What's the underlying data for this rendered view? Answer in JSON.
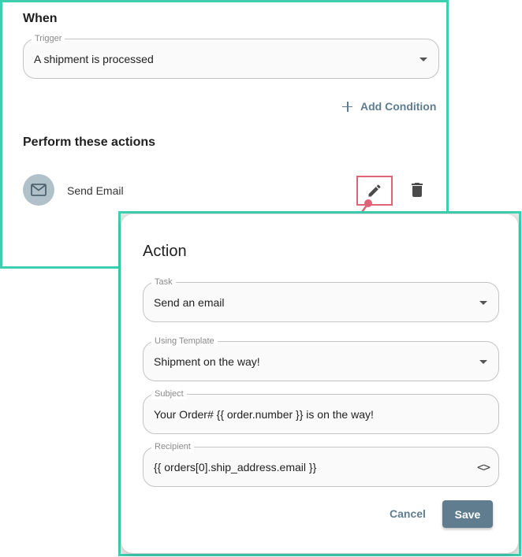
{
  "rule": {
    "when_title": "When",
    "trigger": {
      "label": "Trigger",
      "value": "A shipment is processed"
    },
    "add_condition_label": "Add Condition",
    "perform_title": "Perform these actions",
    "actions": [
      {
        "label": "Send Email",
        "icon": "mail-icon"
      }
    ]
  },
  "dialog": {
    "title": "Action",
    "task": {
      "label": "Task",
      "value": "Send an email"
    },
    "template": {
      "label": "Using Template",
      "value": "Shipment on the way!"
    },
    "subject": {
      "label": "Subject",
      "value": "Your Order# {{ order.number }} is on the way!"
    },
    "recipient": {
      "label": "Recipient",
      "value": "{{ orders[0].ship_address.email }}",
      "code_icon": "<>"
    },
    "cancel_label": "Cancel",
    "save_label": "Save"
  },
  "colors": {
    "highlight_frame": "#3ecfb0",
    "accent": "#5f7d8e",
    "edit_highlight": "#e06377",
    "avatar_bg": "#b1c1c9"
  }
}
